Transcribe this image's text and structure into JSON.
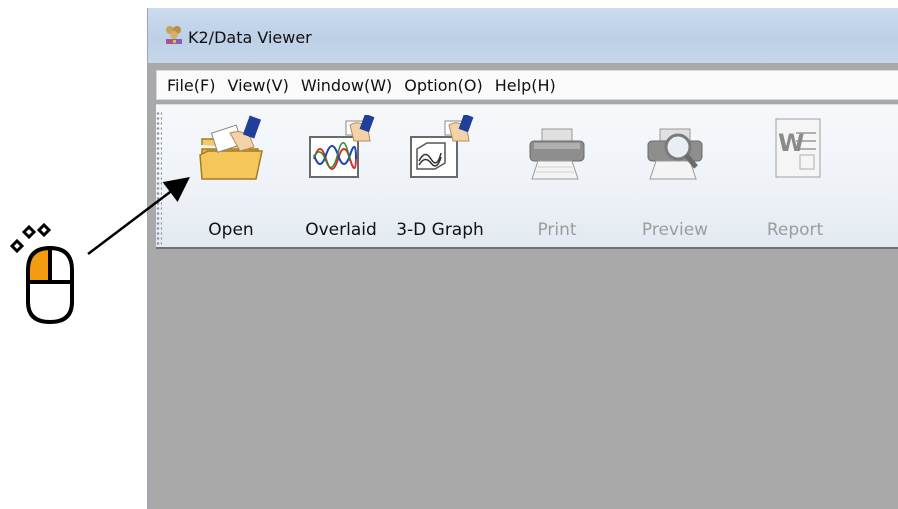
{
  "window": {
    "title": "K2/Data Viewer",
    "icon": "app-logo-icon"
  },
  "menu": {
    "items": [
      "File(F)",
      "View(V)",
      "Window(W)",
      "Option(O)",
      "Help(H)"
    ]
  },
  "toolbar": {
    "buttons": [
      {
        "label": "Open",
        "icon": "open-folder-icon",
        "enabled": true
      },
      {
        "label": "Overlaid",
        "icon": "overlaid-graph-icon",
        "enabled": true
      },
      {
        "label": "3-D Graph",
        "icon": "3d-graph-icon",
        "enabled": true
      },
      {
        "label": "Print",
        "icon": "printer-icon",
        "enabled": false
      },
      {
        "label": "Preview",
        "icon": "print-preview-icon",
        "enabled": false
      },
      {
        "label": "Report",
        "icon": "word-report-icon",
        "enabled": false
      }
    ]
  },
  "annotation": {
    "icon": "mouse-left-click-icon",
    "accent_color": "#f39c12"
  }
}
